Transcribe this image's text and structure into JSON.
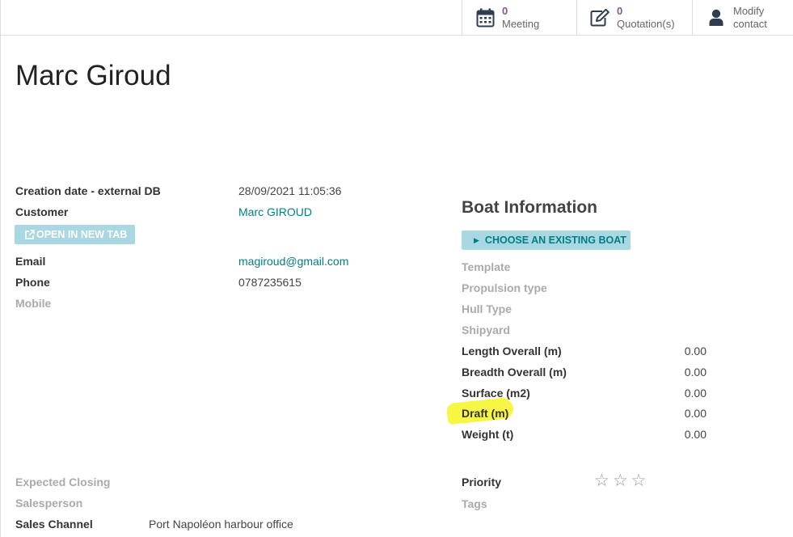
{
  "stat_buttons": {
    "meeting": {
      "count": "0",
      "label": "Meeting",
      "icon": "calendar-icon"
    },
    "quotations": {
      "count": "0",
      "label": "Quotation(s)",
      "icon": "edit-icon"
    },
    "contact": {
      "line1": "Modify",
      "line2": "contact",
      "icon": "user-icon"
    }
  },
  "record": {
    "title": "Marc Giroud"
  },
  "left_fields": {
    "creation_label": "Creation date - external DB",
    "creation_value": "28/09/2021 11:05:36",
    "customer_label": "Customer",
    "customer_value": "Marc GIROUD",
    "open_tab_label": "OPEN IN NEW TAB",
    "email_label": "Email",
    "email_value": "magiroud@gmail.com",
    "phone_label": "Phone",
    "phone_value": "0787235615",
    "mobile_label": "Mobile"
  },
  "boat": {
    "heading": "Boat Information",
    "choose_label": "CHOOSE AN EXISTING BOAT",
    "template_label": "Template",
    "propulsion_label": "Propulsion type",
    "hull_label": "Hull Type",
    "shipyard_label": "Shipyard",
    "length_label": "Length Overall (m)",
    "length_value": "0.00",
    "breadth_label": "Breadth Overall (m)",
    "breadth_value": "0.00",
    "surface_label": "Surface (m2)",
    "surface_value": "0.00",
    "draft_label": "Draft (m)",
    "draft_value": "0.00",
    "weight_label": "Weight (t)",
    "weight_value": "0.00"
  },
  "bottom": {
    "expected_closing_label": "Expected Closing",
    "salesperson_label": "Salesperson",
    "sales_channel_label": "Sales Channel",
    "sales_channel_value": "Port Napoléon harbour office",
    "priority_label": "Priority",
    "priority_stars": 0,
    "tags_label": "Tags"
  },
  "colors": {
    "accent": "#017e84",
    "button_bg": "#a9d8e2",
    "stat_count": "#7c5a8c",
    "highlight": "#f7f53a"
  }
}
